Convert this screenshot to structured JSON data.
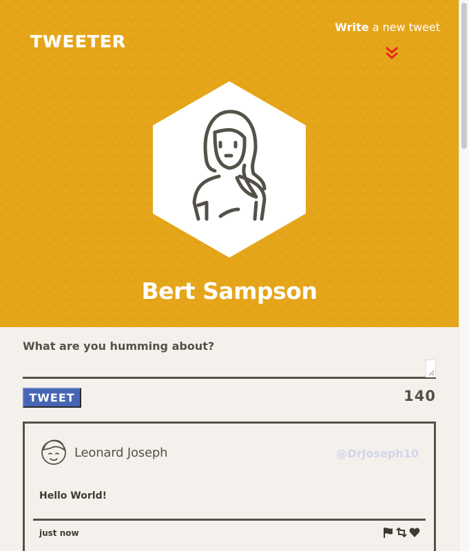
{
  "header": {
    "logo": "TWEETER",
    "compose_link": {
      "bold": "Write",
      "rest": " a new tweet"
    },
    "chevron_icon": "double-chevron-down-icon",
    "accent_color": "#e5a518",
    "chevron_color": "#e0291d"
  },
  "profile": {
    "name": "Bert Sampson",
    "avatar_icon": "person-avatar-icon"
  },
  "compose": {
    "label": "What are you humming about?",
    "input_value": "",
    "button_label": "TWEET",
    "char_count": "140",
    "button_color": "#4766b4"
  },
  "tweets": [
    {
      "author": "Leonard Joseph",
      "handle": "@DrJoseph10",
      "body": "Hello World!",
      "time": "just now",
      "avatar_icon": "user-face-icon",
      "actions": [
        "flag-icon",
        "retweet-icon",
        "heart-icon"
      ]
    }
  ]
}
